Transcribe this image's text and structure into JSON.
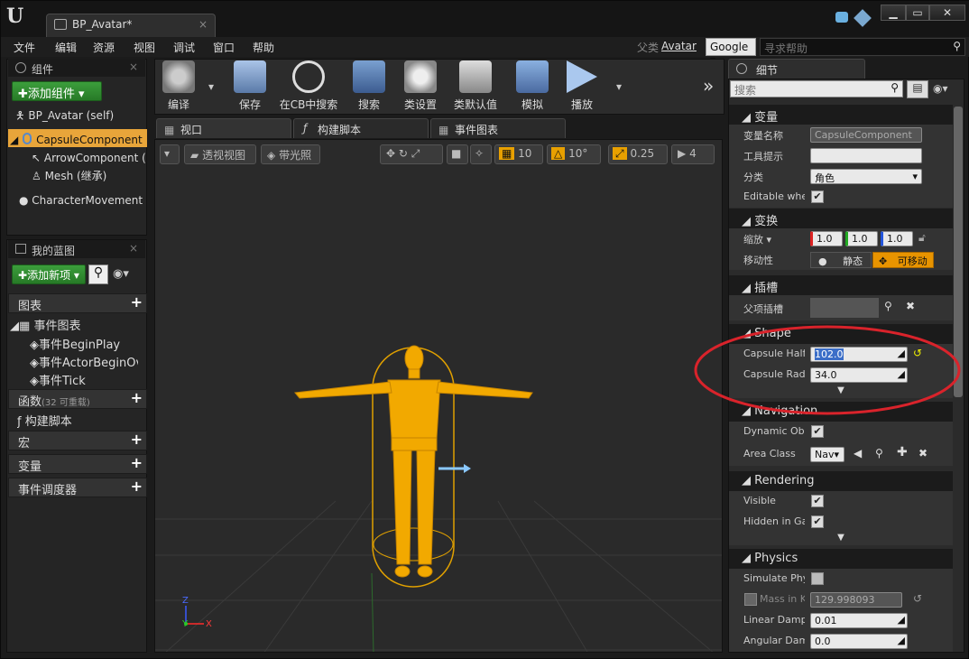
{
  "window": {
    "tab_title": "BP_Avatar*"
  },
  "menu": [
    "文件",
    "编辑",
    "资源",
    "视图",
    "调试",
    "窗口",
    "帮助"
  ],
  "menu_right": {
    "parent_label": "父类",
    "parent_value": "Avatar",
    "search_engine": "Google",
    "help_placeholder": "寻求帮助"
  },
  "components": {
    "title": "组件",
    "add_button": "添加组件",
    "items": [
      "BP_Avatar (self)",
      "CapsuleComponent (继",
      "ArrowComponent (继",
      "Mesh (继承)",
      "CharacterMovement (继"
    ]
  },
  "myblueprint": {
    "title": "我的蓝图",
    "add_new": "添加新项",
    "graphs_label": "图表",
    "event_graph": "事件图表",
    "events": [
      "事件BeginPlay",
      "事件ActorBeginOv",
      "事件Tick"
    ],
    "functions_label": "函数",
    "functions_count": "(32 可重载)",
    "construction_script": "构建脚本",
    "macros": "宏",
    "variables": "变量",
    "dispatchers": "事件调度器"
  },
  "toolbar": [
    "编译",
    "保存",
    "在CB中搜索",
    "搜索",
    "类设置",
    "类默认值",
    "模拟",
    "播放"
  ],
  "editor_tabs": [
    "视口",
    "构建脚本",
    "事件图表"
  ],
  "viewport": {
    "perspective": "透视视图",
    "lit": "带光照",
    "grid_snap": "10",
    "rot_snap": "10°",
    "scale_snap": "0.25",
    "cam_speed": "4",
    "axis": {
      "z": "Z",
      "y": "Y",
      "x": "X"
    }
  },
  "details": {
    "title": "细节",
    "search_placeholder": "搜索",
    "variable": {
      "header": "变量",
      "name_label": "变量名称",
      "name_value": "CapsuleComponent",
      "tooltip_label": "工具提示",
      "tooltip_value": "",
      "category_label": "分类",
      "category_value": "角色",
      "editable_label": "Editable wher"
    },
    "transform": {
      "header": "变换",
      "scale_label": "缩放",
      "scale_x": "1.0",
      "scale_y": "1.0",
      "scale_z": "1.0",
      "mobility_label": "移动性",
      "static": "静态",
      "movable": "可移动"
    },
    "sockets": {
      "header": "插槽",
      "parent_label": "父项插槽"
    },
    "shape": {
      "header": "Shape",
      "half_label": "Capsule Half",
      "half_value": "102.0",
      "radius_label": "Capsule Radi",
      "radius_value": "34.0"
    },
    "navigation": {
      "header": "Navigation",
      "dyn_label": "Dynamic Obs",
      "area_label": "Area Class",
      "area_value": "Nav"
    },
    "rendering": {
      "header": "Rendering",
      "visible_label": "Visible",
      "hidden_label": "Hidden in Gar"
    },
    "physics": {
      "header": "Physics",
      "simulate_label": "Simulate Phy",
      "mass_label": "Mass in K",
      "mass_value": "129.998093",
      "linear_label": "Linear Dampi",
      "linear_value": "0.01",
      "angular_label": "Angular Damp",
      "angular_value": "0.0"
    }
  },
  "colors": {
    "accent_orange": "#f0a000",
    "highlight": "#e8a53a",
    "annotation_red": "#d9232b"
  }
}
